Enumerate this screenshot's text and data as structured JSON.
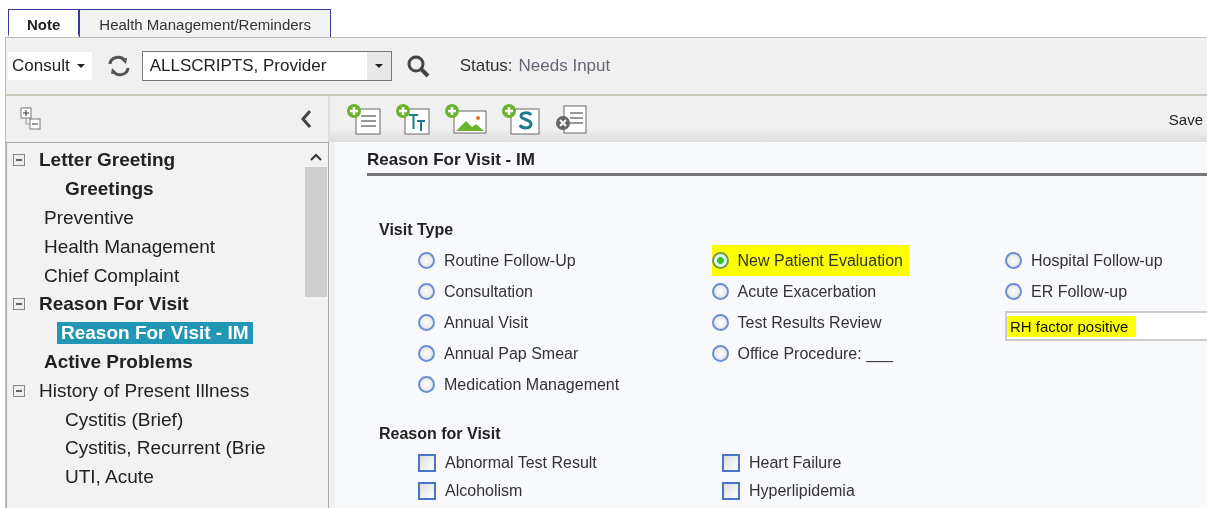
{
  "tabs": [
    {
      "label": "Note",
      "selected": true
    },
    {
      "label": "Health Management/Reminders",
      "selected": false
    }
  ],
  "toolbar": {
    "note_type": "Consult",
    "provider": "ALLSCRIPTS, Provider",
    "status_label": "Status:",
    "status_value": "Needs Input",
    "save": "Save"
  },
  "tree": [
    {
      "label": "Letter Greeting",
      "bold": true,
      "selected": false,
      "expanded": true,
      "children": [
        {
          "label": "Greetings",
          "bold": true,
          "selected": false
        }
      ]
    },
    {
      "label": "Preventive",
      "bold": false,
      "selected": false
    },
    {
      "label": "Health Management",
      "bold": false,
      "selected": false
    },
    {
      "label": "Chief Complaint",
      "bold": false,
      "selected": false
    },
    {
      "label": "Reason For Visit",
      "bold": true,
      "selected": false,
      "expanded": true,
      "children": [
        {
          "label": "Reason For Visit - IM",
          "bold": true,
          "selected": true
        }
      ]
    },
    {
      "label": "Active Problems",
      "bold": true,
      "selected": false
    },
    {
      "label": "History of Present Illness",
      "bold": false,
      "selected": false,
      "expanded": true,
      "children": [
        {
          "label": "Cystitis (Brief)",
          "bold": false,
          "selected": false
        },
        {
          "label": "Cystitis, Recurrent (Brie",
          "bold": false,
          "selected": false
        },
        {
          "label": "UTI, Acute",
          "bold": false,
          "selected": false
        }
      ]
    }
  ],
  "form": {
    "title": "Reason For Visit - IM",
    "visit_type": {
      "heading": "Visit Type",
      "columns": [
        [
          {
            "kind": "radio",
            "label": "Routine Follow-Up",
            "selected": false,
            "highlighted": false
          },
          {
            "kind": "radio",
            "label": "Consultation",
            "selected": false,
            "highlighted": false
          },
          {
            "kind": "radio",
            "label": "Annual Visit",
            "selected": false,
            "highlighted": false
          },
          {
            "kind": "radio",
            "label": "Annual Pap Smear",
            "selected": false,
            "highlighted": false
          },
          {
            "kind": "radio",
            "label": "Medication Management",
            "selected": false,
            "highlighted": false
          }
        ],
        [
          {
            "kind": "radio",
            "label": "New Patient Evaluation",
            "selected": true,
            "highlighted": true
          },
          {
            "kind": "radio",
            "label": "Acute Exacerbation",
            "selected": false,
            "highlighted": false
          },
          {
            "kind": "radio",
            "label": "Test Results Review",
            "selected": false,
            "highlighted": false
          },
          {
            "kind": "radio",
            "label": "Office Procedure: ___",
            "selected": false,
            "highlighted": false
          }
        ],
        [
          {
            "kind": "radio",
            "label": "Hospital Follow-up",
            "selected": false,
            "highlighted": false
          },
          {
            "kind": "radio",
            "label": "ER Follow-up",
            "selected": false,
            "highlighted": false
          },
          {
            "kind": "field",
            "value": "RH factor positive",
            "highlighted": true
          }
        ]
      ]
    },
    "reason": {
      "heading": "Reason for Visit",
      "columns": [
        [
          {
            "label": "Abnormal Test Result",
            "checked": false
          },
          {
            "label": "Alcoholism",
            "checked": false
          }
        ],
        [
          {
            "label": "Heart Failure",
            "checked": false
          },
          {
            "label": "Hyperlipidemia",
            "checked": false
          }
        ]
      ]
    }
  }
}
